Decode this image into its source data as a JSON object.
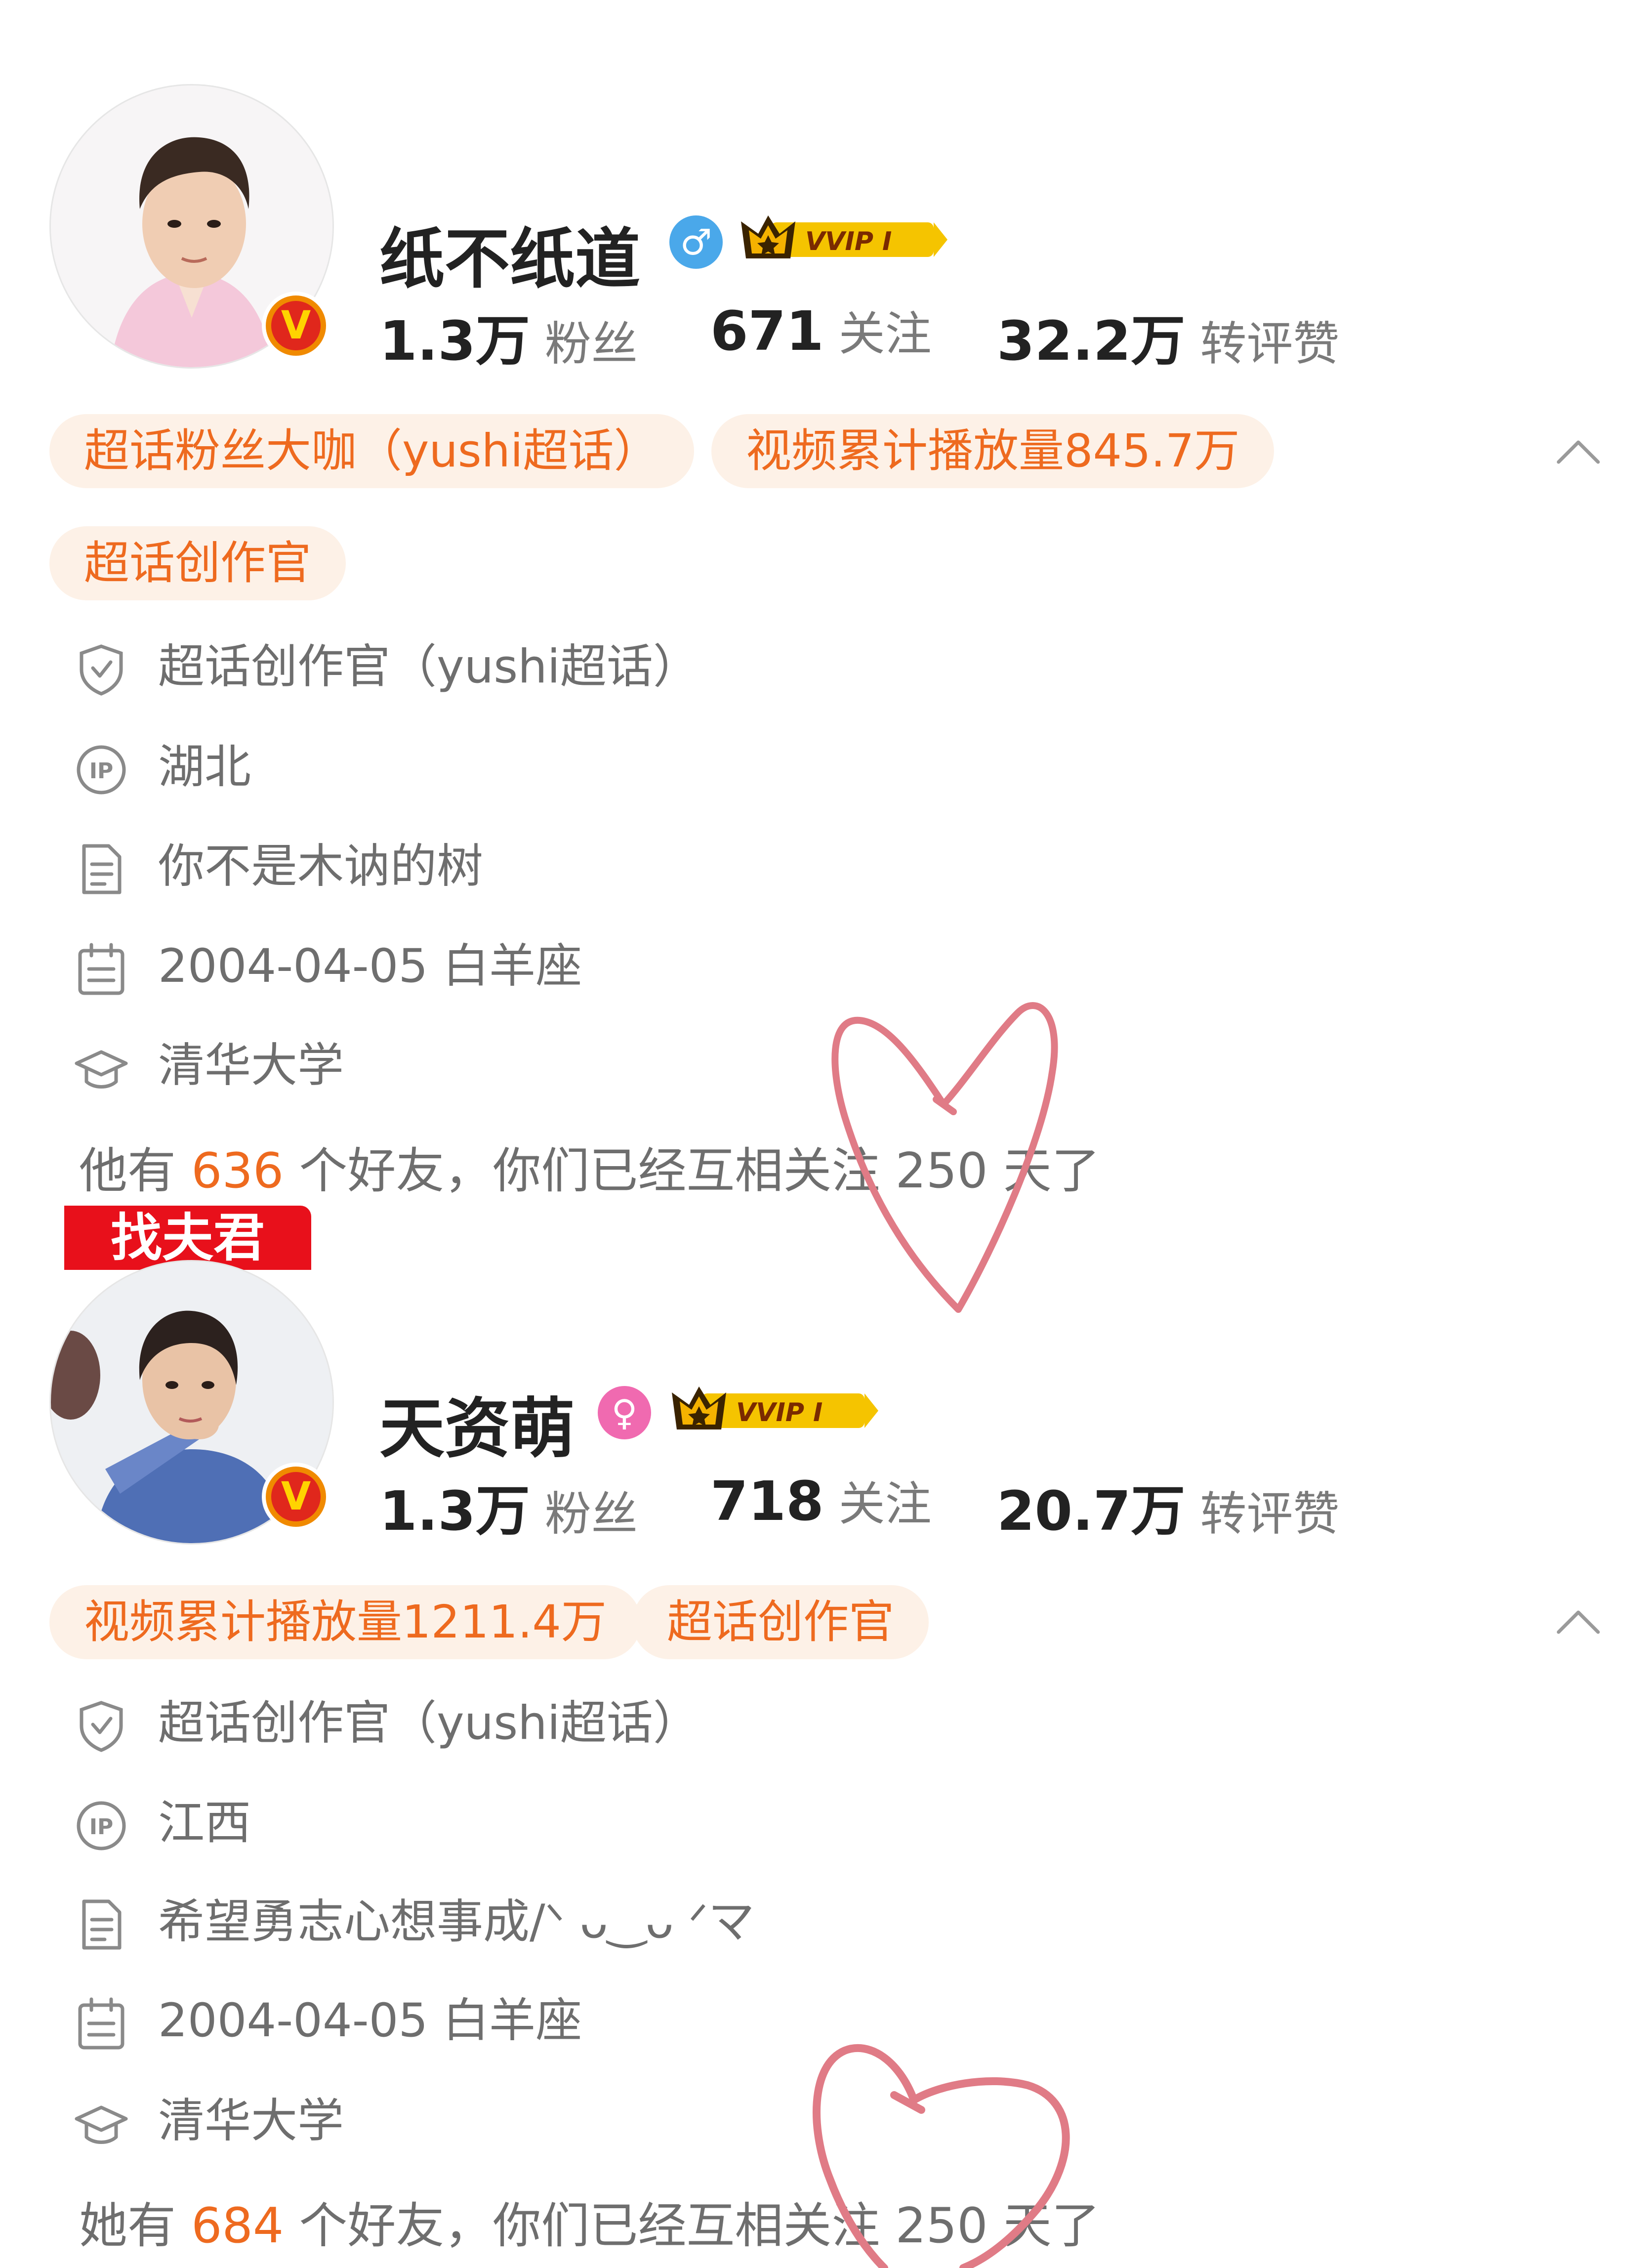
{
  "profiles": [
    {
      "name": "纸不纸道",
      "gender_symbol": "♂",
      "vvip_label": "VVIP I",
      "stats": {
        "fans_num": "1.3万",
        "fans_label": "粉丝",
        "follow_num": "671",
        "follow_label": "关注",
        "likes_num": "32.2万",
        "likes_label": "转评赞"
      },
      "tags": [
        "超话粉丝大咖（yushi超话）",
        "视频累计播放量845.7万",
        "超话创作官"
      ],
      "info": {
        "role": "超话创作官（yushi超话）",
        "location": "湖北",
        "bio": "你不是木讷的树",
        "birthday": "2004-04-05 白羊座",
        "school": "清华大学"
      },
      "friends": {
        "prefix": "他有 ",
        "count": "636",
        "suffix": " 个好友，你们已经互相关注 250 天了"
      }
    },
    {
      "banner": "找夫君",
      "name": "天资萌",
      "gender_symbol": "♀",
      "vvip_label": "VVIP I",
      "stats": {
        "fans_num": "1.3万",
        "fans_label": "粉丝",
        "follow_num": "718",
        "follow_label": "关注",
        "likes_num": "20.7万",
        "likes_label": "转评赞"
      },
      "tags": [
        "视频累计播放量1211.4万",
        "超话创作官"
      ],
      "info": {
        "role": "超话创作官（yushi超话）",
        "location": "江西",
        "bio": "希望勇志心想事成/ᐠ ᴗ‿ᴗ ᐟマ",
        "birthday": "2004-04-05 白羊座",
        "school": "清华大学"
      },
      "friends": {
        "prefix": "她有 ",
        "count": "684",
        "suffix": " 个好友，你们已经互相关注 250 天了"
      }
    }
  ],
  "colors": {
    "accent": "#ee6a1f",
    "tag_bg": "#fdf1e7",
    "male": "#4aa8ea",
    "female": "#f06ab0",
    "heart": "#e07b86"
  }
}
